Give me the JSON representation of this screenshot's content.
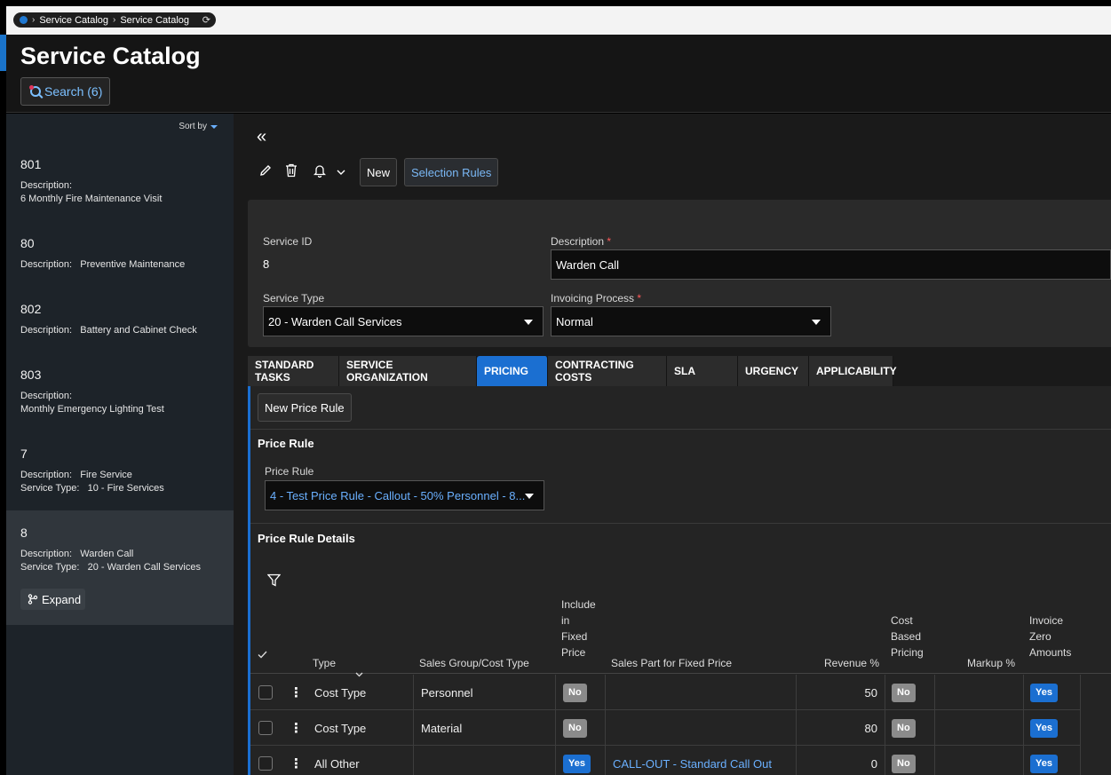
{
  "breadcrumb": {
    "items": [
      "Service Catalog",
      "Service Catalog"
    ]
  },
  "header": {
    "title": "Service Catalog",
    "search_label": "Search (6)"
  },
  "sidebar": {
    "sort_label": "Sort by",
    "expand_label": "Expand",
    "items": [
      {
        "id": "801",
        "lines": [
          "Description:",
          "6 Monthly Fire Maintenance Visit"
        ]
      },
      {
        "id": "80",
        "lines": [
          "Description:   Preventive Maintenance"
        ]
      },
      {
        "id": "802",
        "lines": [
          "Description:   Battery and Cabinet Check"
        ]
      },
      {
        "id": "803",
        "lines": [
          "Description:",
          "Monthly Emergency Lighting Test"
        ]
      },
      {
        "id": "7",
        "lines": [
          "Description:   Fire Service",
          "Service Type:   10 - Fire Services"
        ]
      },
      {
        "id": "8",
        "lines": [
          "Description:   Warden Call",
          "Service Type:   20 - Warden Call Services"
        ],
        "selected": true
      }
    ]
  },
  "toolbar": {
    "new_label": "New",
    "selection_rules_label": "Selection Rules"
  },
  "form": {
    "service_id_label": "Service ID",
    "service_id": "8",
    "description_label": "Description",
    "description": "Warden Call",
    "service_type_label": "Service Type",
    "service_type": "20 - Warden Call Services",
    "invoicing_label": "Invoicing Process",
    "invoicing": "Normal",
    "required_mark": "*"
  },
  "tabs": [
    {
      "label": "STANDARD TASKS"
    },
    {
      "label": "SERVICE ORGANIZATION"
    },
    {
      "label": "PRICING",
      "active": true
    },
    {
      "label": "CONTRACTING COSTS"
    },
    {
      "label": "SLA"
    },
    {
      "label": "URGENCY"
    },
    {
      "label": "APPLICABILITY"
    }
  ],
  "pricing": {
    "new_price_rule_label": "New Price Rule",
    "price_rule_section": "Price Rule",
    "price_rule_label": "Price Rule",
    "price_rule_value": "4 - Test Price Rule - Callout - 50% Personnel - 8...",
    "details_section": "Price Rule Details"
  },
  "table": {
    "headers": {
      "type": "Type",
      "sales_group": "Sales Group/Cost Type",
      "include": [
        "Include",
        "in",
        "Fixed",
        "Price"
      ],
      "sales_part": "Sales Part for Fixed Price",
      "revenue": "Revenue %",
      "cost_based": [
        "Cost",
        "Based",
        "Pricing"
      ],
      "markup": "Markup %",
      "invoice_zero": [
        "Invoice",
        "Zero",
        "Amounts"
      ]
    },
    "rows": [
      {
        "type": "Cost Type",
        "sales_group": "Personnel",
        "include": "No",
        "sales_part": "",
        "revenue": "50",
        "cost_based": "No",
        "markup": "",
        "invoice_zero": "Yes"
      },
      {
        "type": "Cost Type",
        "sales_group": "Material",
        "include": "No",
        "sales_part": "",
        "revenue": "80",
        "cost_based": "No",
        "markup": "",
        "invoice_zero": "Yes"
      },
      {
        "type": "All Other",
        "sales_group": "",
        "include": "Yes",
        "sales_part": "CALL-OUT - Standard Call Out",
        "revenue": "0",
        "cost_based": "No",
        "markup": "",
        "invoice_zero": "Yes"
      }
    ]
  }
}
